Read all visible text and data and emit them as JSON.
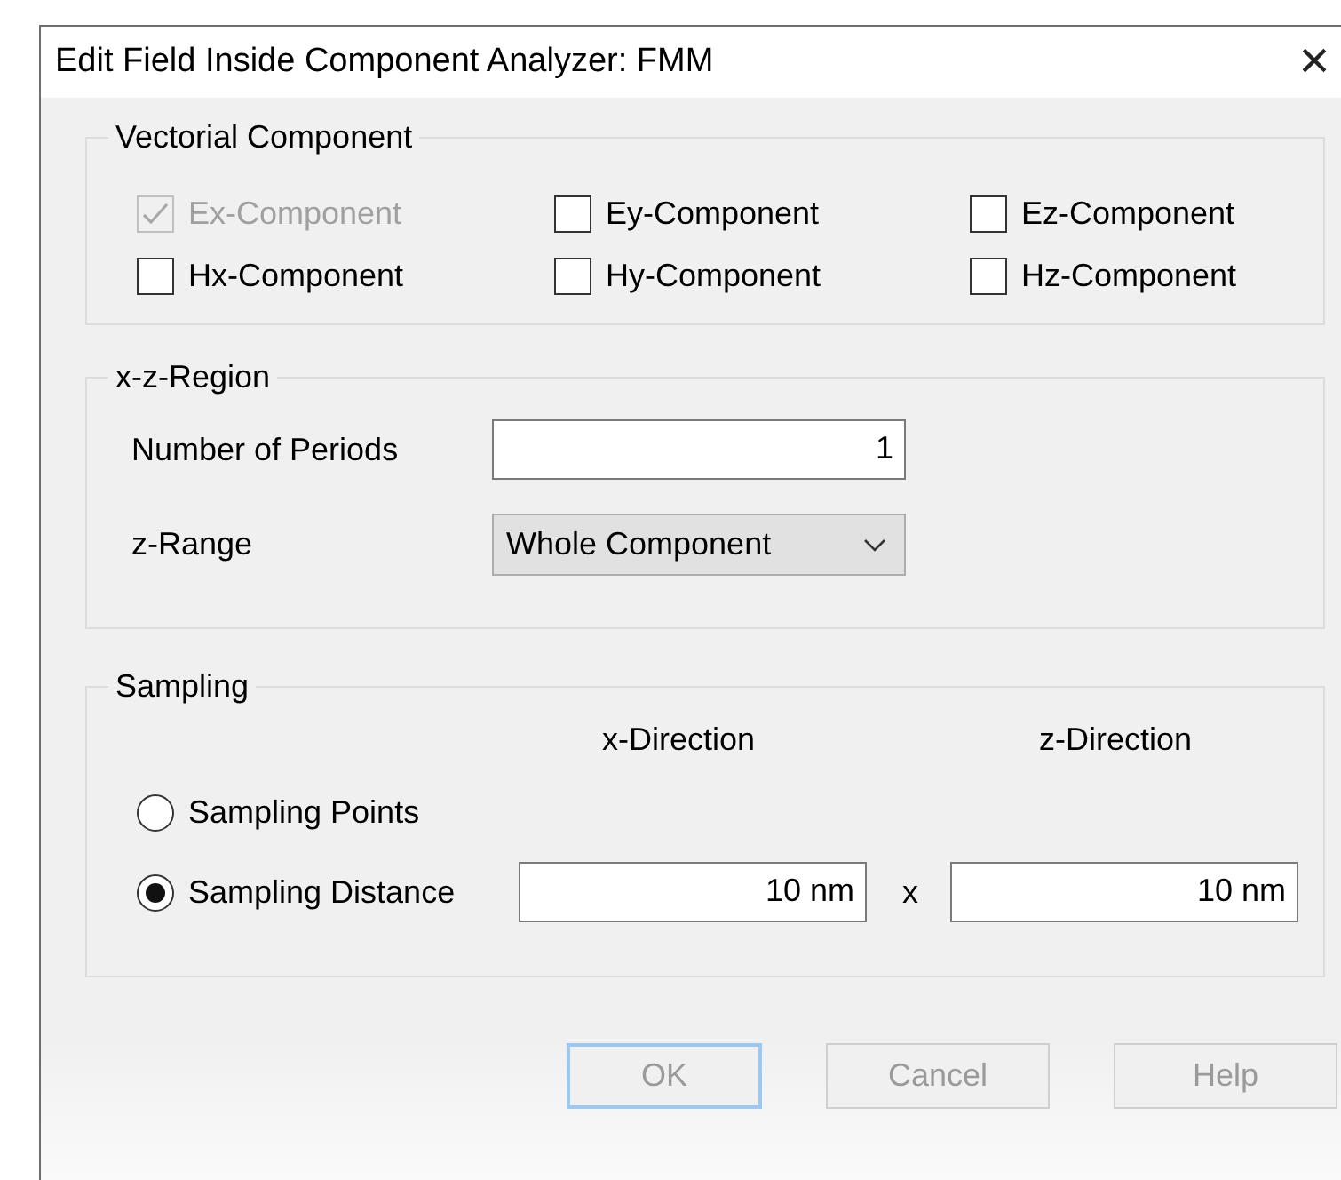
{
  "window": {
    "title": "Edit Field Inside Component Analyzer: FMM",
    "close": "×"
  },
  "vectorial_component": {
    "title": "Vectorial Component",
    "checkboxes": [
      {
        "label": "Ex-Component",
        "checked": true,
        "disabled": true
      },
      {
        "label": "Ey-Component",
        "checked": false,
        "disabled": false
      },
      {
        "label": "Ez-Component",
        "checked": false,
        "disabled": false
      },
      {
        "label": "Hx-Component",
        "checked": false,
        "disabled": false
      },
      {
        "label": "Hy-Component",
        "checked": false,
        "disabled": false
      },
      {
        "label": "Hz-Component",
        "checked": false,
        "disabled": false
      }
    ]
  },
  "xz_region": {
    "title": "x-z-Region",
    "number_of_periods": {
      "label": "Number of Periods",
      "value": "1"
    },
    "z_range": {
      "label": "z-Range",
      "value": "Whole Component"
    }
  },
  "sampling": {
    "title": "Sampling",
    "x_header": "x-Direction",
    "z_header": "z-Direction",
    "options": [
      {
        "label": "Sampling Points",
        "selected": false
      },
      {
        "label": "Sampling Distance",
        "selected": true
      }
    ],
    "x_value": "10 nm",
    "separator": "x",
    "z_value": "10 nm"
  },
  "buttons": [
    {
      "label": "OK",
      "default": true,
      "disabled": true
    },
    {
      "label": "Cancel",
      "default": false,
      "disabled": true
    },
    {
      "label": "Help",
      "default": false,
      "disabled": true
    }
  ]
}
